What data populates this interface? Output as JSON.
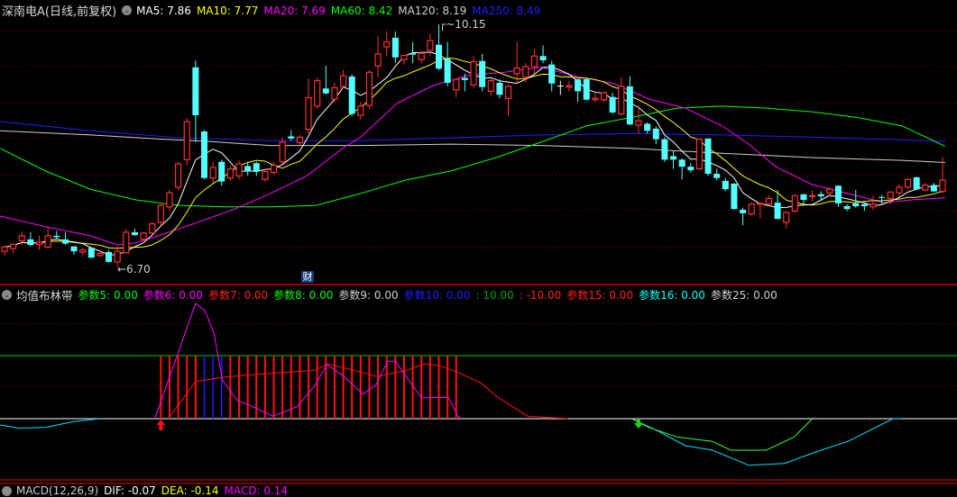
{
  "header": {
    "title": "深南电A(日线,前复权)",
    "ma": [
      {
        "label": "MA5: 7.86",
        "color": "#ffffff"
      },
      {
        "label": "MA10: 7.77",
        "color": "#ffff00"
      },
      {
        "label": "MA20: 7.69",
        "color": "#ff00ff"
      },
      {
        "label": "MA60: 8.42",
        "color": "#00ff00"
      },
      {
        "label": "MA120: 8.19",
        "color": "#cfcfcf"
      },
      {
        "label": "MA250: 8.49",
        "color": "#1e1eff"
      }
    ]
  },
  "annotations": {
    "high": "10.15",
    "low": "6.70",
    "finance_badge": "财"
  },
  "indicator": {
    "title": "均值布林带",
    "params": [
      {
        "label": "参数5: 0.00",
        "color": "#00ff00"
      },
      {
        "label": "参数6: 0.00",
        "color": "#ff00ff"
      },
      {
        "label": "参数7: 0.00",
        "color": "#ff2020"
      },
      {
        "label": "参数8: 0.00",
        "color": "#00ff00"
      },
      {
        "label": "参数9: 0.00",
        "color": "#cfcfcf"
      },
      {
        "label": "参数10: 0.00",
        "color": "#1e1eff"
      },
      {
        "label": ": 10.00",
        "color": "#00a000"
      },
      {
        "label": ": -10.00",
        "color": "#ff2020"
      },
      {
        "label": "参数15: 0.00",
        "color": "#ff2020"
      },
      {
        "label": "参数16: 0.00",
        "color": "#00ffff"
      },
      {
        "label": "参数25: 0.00",
        "color": "#cfcfcf"
      }
    ],
    "signal_bars": {
      "from": 18,
      "to": 52,
      "blue": [
        23,
        24,
        25
      ]
    },
    "buy_signal_index": 18,
    "sell_signal_index": 73,
    "upper_level": 100,
    "magenta": [
      [
        17.3,
        0
      ],
      [
        22,
        183
      ],
      [
        23.1,
        171
      ],
      [
        24.1,
        136
      ],
      [
        25.1,
        61
      ],
      [
        26.8,
        29
      ],
      [
        28.9,
        17
      ],
      [
        30.9,
        4
      ],
      [
        33.7,
        19
      ],
      [
        35.8,
        54
      ],
      [
        37.1,
        86
      ],
      [
        38.9,
        69
      ],
      [
        41.3,
        39
      ],
      [
        42.8,
        54
      ],
      [
        44.1,
        91
      ],
      [
        45,
        91
      ],
      [
        48,
        33
      ],
      [
        51.1,
        34
      ],
      [
        52.2,
        4
      ],
      [
        52.6,
        0
      ]
    ],
    "red": [
      [
        19,
        3
      ],
      [
        22,
        59
      ],
      [
        25.4,
        66
      ],
      [
        28.9,
        70
      ],
      [
        35.8,
        77
      ],
      [
        37.2,
        87
      ],
      [
        41,
        74
      ],
      [
        42.8,
        67
      ],
      [
        46.2,
        76
      ],
      [
        48.3,
        87
      ],
      [
        50.1,
        84
      ],
      [
        52.1,
        74
      ],
      [
        54.8,
        57
      ],
      [
        56.6,
        36
      ],
      [
        60.2,
        4
      ],
      [
        64.9,
        0
      ]
    ],
    "cyan": [
      [
        [
          -0.5,
          -10
        ],
        [
          1.6,
          -15
        ],
        [
          4.7,
          -14
        ],
        [
          7.8,
          -5
        ],
        [
          10.9,
          0
        ]
      ],
      [
        [
          72.2,
          0
        ],
        [
          75.3,
          -20
        ],
        [
          78.4,
          -43
        ],
        [
          81.5,
          -50
        ],
        [
          85.7,
          -74
        ],
        [
          89.8,
          -71
        ],
        [
          94,
          -50
        ],
        [
          97.1,
          -36
        ],
        [
          102.3,
          0
        ],
        [
          103.3,
          0
        ]
      ]
    ],
    "green": [
      [
        72.2,
        0
      ],
      [
        74.2,
        -14
      ],
      [
        77.4,
        -29
      ],
      [
        81.5,
        -36
      ],
      [
        83.6,
        -50
      ],
      [
        87.7,
        -50
      ],
      [
        90.9,
        -29
      ],
      [
        93,
        0
      ]
    ]
  },
  "macd": {
    "label_name": "MACD(12,26,9)",
    "dif": "DIF: -0.07",
    "dea": "DEA: -0.14",
    "macd": "MACD: 0.14"
  },
  "chart_data": {
    "type": "candlestick",
    "ohlc_format": "[open, close, high, low]",
    "candles": [
      [
        6.93,
        6.99,
        7.01,
        6.87
      ],
      [
        6.97,
        7.03,
        7.04,
        6.9
      ],
      [
        7.08,
        7.15,
        7.21,
        7.02
      ],
      [
        7.1,
        7.02,
        7.2,
        7.0
      ],
      [
        7.03,
        7.06,
        7.15,
        6.95
      ],
      [
        6.99,
        7.15,
        7.27,
        6.97
      ],
      [
        7.15,
        7.13,
        7.22,
        7.1
      ],
      [
        7.1,
        7.04,
        7.2,
        7.02
      ],
      [
        7.0,
        6.93,
        7.0,
        6.88
      ],
      [
        6.92,
        6.95,
        6.98,
        6.86
      ],
      [
        6.98,
        6.84,
        6.99,
        6.83
      ],
      [
        6.87,
        6.9,
        6.95,
        6.85
      ],
      [
        6.92,
        6.78,
        6.95,
        6.77
      ],
      [
        6.78,
        6.93,
        7.0,
        6.7
      ],
      [
        6.91,
        7.2,
        7.25,
        6.9
      ],
      [
        7.2,
        7.16,
        7.25,
        7.15
      ],
      [
        7.1,
        7.19,
        7.2,
        7.08
      ],
      [
        7.19,
        7.32,
        7.35,
        7.17
      ],
      [
        7.34,
        7.58,
        7.62,
        7.3
      ],
      [
        7.56,
        7.76,
        7.8,
        7.5
      ],
      [
        7.84,
        8.17,
        8.2,
        7.8
      ],
      [
        8.23,
        8.77,
        8.82,
        8.15
      ],
      [
        9.54,
        8.86,
        9.64,
        8.48
      ],
      [
        8.63,
        7.97,
        8.65,
        7.95
      ],
      [
        7.97,
        8.12,
        8.2,
        7.9
      ],
      [
        8.2,
        7.92,
        8.23,
        7.86
      ],
      [
        7.97,
        8.1,
        8.15,
        7.93
      ],
      [
        8.0,
        8.17,
        8.22,
        7.95
      ],
      [
        8.14,
        8.06,
        8.2,
        8.0
      ],
      [
        8.18,
        8.06,
        8.2,
        8.0
      ],
      [
        7.95,
        8.06,
        8.1,
        7.92
      ],
      [
        8.05,
        8.15,
        8.2,
        8.02
      ],
      [
        8.2,
        8.48,
        8.55,
        8.17
      ],
      [
        8.56,
        8.53,
        8.65,
        8.5
      ],
      [
        8.47,
        8.55,
        8.58,
        8.44
      ],
      [
        8.66,
        9.11,
        9.38,
        8.6
      ],
      [
        8.99,
        9.35,
        9.4,
        8.95
      ],
      [
        9.24,
        9.17,
        9.56,
        9.15
      ],
      [
        9.09,
        9.25,
        9.32,
        9.05
      ],
      [
        9.27,
        9.42,
        9.5,
        9.25
      ],
      [
        9.41,
        8.88,
        9.44,
        8.85
      ],
      [
        8.86,
        8.99,
        9.05,
        8.8
      ],
      [
        9.0,
        9.47,
        9.5,
        8.95
      ],
      [
        9.56,
        9.73,
        9.98,
        9.4
      ],
      [
        9.83,
        9.9,
        10.05,
        9.7
      ],
      [
        9.96,
        9.68,
        10.05,
        9.6
      ],
      [
        9.65,
        9.71,
        9.72,
        9.58
      ],
      [
        9.74,
        9.72,
        9.9,
        9.6
      ],
      [
        9.65,
        9.74,
        9.78,
        9.6
      ],
      [
        9.78,
        9.92,
        10.02,
        9.7
      ],
      [
        9.86,
        9.52,
        10.15,
        9.5
      ],
      [
        9.66,
        9.32,
        9.9,
        9.27
      ],
      [
        9.22,
        9.37,
        9.38,
        9.12
      ],
      [
        9.39,
        9.36,
        9.45,
        9.2
      ],
      [
        9.29,
        9.62,
        9.7,
        9.25
      ],
      [
        9.63,
        9.26,
        9.73,
        9.2
      ],
      [
        9.2,
        9.35,
        9.38,
        9.13
      ],
      [
        9.32,
        9.15,
        9.37,
        9.1
      ],
      [
        9.1,
        9.27,
        9.3,
        8.85
      ],
      [
        9.45,
        9.53,
        9.9,
        9.3
      ],
      [
        9.4,
        9.55,
        9.6,
        9.33
      ],
      [
        9.55,
        9.7,
        9.8,
        9.45
      ],
      [
        9.7,
        9.64,
        9.85,
        9.6
      ],
      [
        9.58,
        9.31,
        9.63,
        9.2
      ],
      [
        9.28,
        9.28,
        9.35,
        9.15
      ],
      [
        9.26,
        9.28,
        9.35,
        9.2
      ],
      [
        9.37,
        9.2,
        9.38,
        9.05
      ],
      [
        9.37,
        9.08,
        9.4,
        9.07
      ],
      [
        9.08,
        9.1,
        9.18,
        9.05
      ],
      [
        9.08,
        9.18,
        9.2,
        9.05
      ],
      [
        9.12,
        8.9,
        9.18,
        8.88
      ],
      [
        8.88,
        9.27,
        9.4,
        8.85
      ],
      [
        9.27,
        8.73,
        9.41,
        8.72
      ],
      [
        8.72,
        8.78,
        9.0,
        8.6
      ],
      [
        8.74,
        8.64,
        8.76,
        8.6
      ],
      [
        8.67,
        8.52,
        8.7,
        8.45
      ],
      [
        8.52,
        8.23,
        8.55,
        8.2
      ],
      [
        8.28,
        8.23,
        8.35,
        8.1
      ],
      [
        8.23,
        8.13,
        8.25,
        7.95
      ],
      [
        8.13,
        8.08,
        8.18,
        8.05
      ],
      [
        8.1,
        8.52,
        8.53,
        8.08
      ],
      [
        8.53,
        8.03,
        8.53,
        8.0
      ],
      [
        8.03,
        7.97,
        8.1,
        7.94
      ],
      [
        7.93,
        7.81,
        7.97,
        7.78
      ],
      [
        7.89,
        7.53,
        7.9,
        7.52
      ],
      [
        7.52,
        7.47,
        7.55,
        7.3
      ],
      [
        7.46,
        7.6,
        7.62,
        7.44
      ],
      [
        7.6,
        7.61,
        7.62,
        7.4
      ],
      [
        7.6,
        7.68,
        7.72,
        7.58
      ],
      [
        7.62,
        7.39,
        7.8,
        7.38
      ],
      [
        7.34,
        7.48,
        7.5,
        7.25
      ],
      [
        7.5,
        7.72,
        7.74,
        7.48
      ],
      [
        7.74,
        7.66,
        7.74,
        7.6
      ],
      [
        7.71,
        7.72,
        7.8,
        7.64
      ],
      [
        7.74,
        7.71,
        7.78,
        7.66
      ],
      [
        7.76,
        7.81,
        7.84,
        7.7
      ],
      [
        7.86,
        7.61,
        7.87,
        7.56
      ],
      [
        7.57,
        7.53,
        7.6,
        7.5
      ],
      [
        7.61,
        7.57,
        7.8,
        7.55
      ],
      [
        7.6,
        7.57,
        7.62,
        7.5
      ],
      [
        7.56,
        7.6,
        7.72,
        7.52
      ],
      [
        7.7,
        7.69,
        7.73,
        7.6
      ],
      [
        7.68,
        7.77,
        7.78,
        7.6
      ],
      [
        7.76,
        7.84,
        7.88,
        7.7
      ],
      [
        7.84,
        7.95,
        7.96,
        7.82
      ],
      [
        7.98,
        7.81,
        7.99,
        7.8
      ],
      [
        7.8,
        7.87,
        7.9,
        7.78
      ],
      [
        7.87,
        7.78,
        7.9,
        7.77
      ],
      [
        7.78,
        7.94,
        8.27,
        7.75
      ]
    ],
    "moving_averages": {
      "MA20": [
        [
          -0.5,
          7.43
        ],
        [
          4.7,
          7.28
        ],
        [
          9.9,
          7.15
        ],
        [
          13,
          7.02
        ],
        [
          15.1,
          7.05
        ],
        [
          17.7,
          7.15
        ],
        [
          21.3,
          7.3
        ],
        [
          26.5,
          7.53
        ],
        [
          30.6,
          7.75
        ],
        [
          34.8,
          8.0
        ],
        [
          38.9,
          8.39
        ],
        [
          41,
          8.55
        ],
        [
          45.2,
          9.03
        ],
        [
          49.3,
          9.28
        ],
        [
          53.5,
          9.43
        ],
        [
          57.6,
          9.47
        ],
        [
          61.8,
          9.54
        ],
        [
          65.9,
          9.41
        ],
        [
          70.1,
          9.31
        ],
        [
          74.2,
          9.09
        ],
        [
          78.4,
          8.96
        ],
        [
          82.6,
          8.71
        ],
        [
          85.7,
          8.45
        ],
        [
          88.8,
          8.13
        ],
        [
          92.9,
          7.88
        ],
        [
          97.1,
          7.75
        ],
        [
          101.2,
          7.62
        ],
        [
          104.4,
          7.66
        ],
        [
          108.3,
          7.69
        ]
      ],
      "MA60": [
        [
          -0.5,
          8.39
        ],
        [
          4.7,
          8.07
        ],
        [
          9.9,
          7.81
        ],
        [
          15.1,
          7.66
        ],
        [
          20.2,
          7.58
        ],
        [
          25.4,
          7.56
        ],
        [
          30.6,
          7.56
        ],
        [
          35.8,
          7.58
        ],
        [
          41,
          7.75
        ],
        [
          46.2,
          7.94
        ],
        [
          51.4,
          8.07
        ],
        [
          56.6,
          8.26
        ],
        [
          61.8,
          8.48
        ],
        [
          67,
          8.71
        ],
        [
          72.2,
          8.83
        ],
        [
          77.4,
          8.96
        ],
        [
          82.6,
          8.99
        ],
        [
          87.7,
          8.96
        ],
        [
          92.9,
          8.91
        ],
        [
          98.1,
          8.83
        ],
        [
          103.3,
          8.71
        ],
        [
          108.3,
          8.42
        ]
      ],
      "MA120": [
        [
          -0.5,
          8.64
        ],
        [
          9.9,
          8.58
        ],
        [
          18.2,
          8.52
        ],
        [
          23.4,
          8.49
        ],
        [
          30.6,
          8.43
        ],
        [
          41,
          8.43
        ],
        [
          51.4,
          8.45
        ],
        [
          61.8,
          8.43
        ],
        [
          72.2,
          8.39
        ],
        [
          82.6,
          8.32
        ],
        [
          92.9,
          8.26
        ],
        [
          103.3,
          8.22
        ],
        [
          108.3,
          8.19
        ]
      ],
      "MA250": [
        [
          -0.5,
          8.77
        ],
        [
          9.9,
          8.64
        ],
        [
          20.2,
          8.54
        ],
        [
          30.6,
          8.5
        ],
        [
          41,
          8.5
        ],
        [
          51.4,
          8.54
        ],
        [
          61.8,
          8.58
        ],
        [
          72.2,
          8.6
        ],
        [
          82.6,
          8.58
        ],
        [
          92.9,
          8.55
        ],
        [
          103.3,
          8.51
        ],
        [
          108.3,
          8.49
        ]
      ]
    },
    "computed_averages": [
      "MA5",
      "MA10"
    ],
    "price_range": [
      6.7,
      10.15
    ]
  }
}
